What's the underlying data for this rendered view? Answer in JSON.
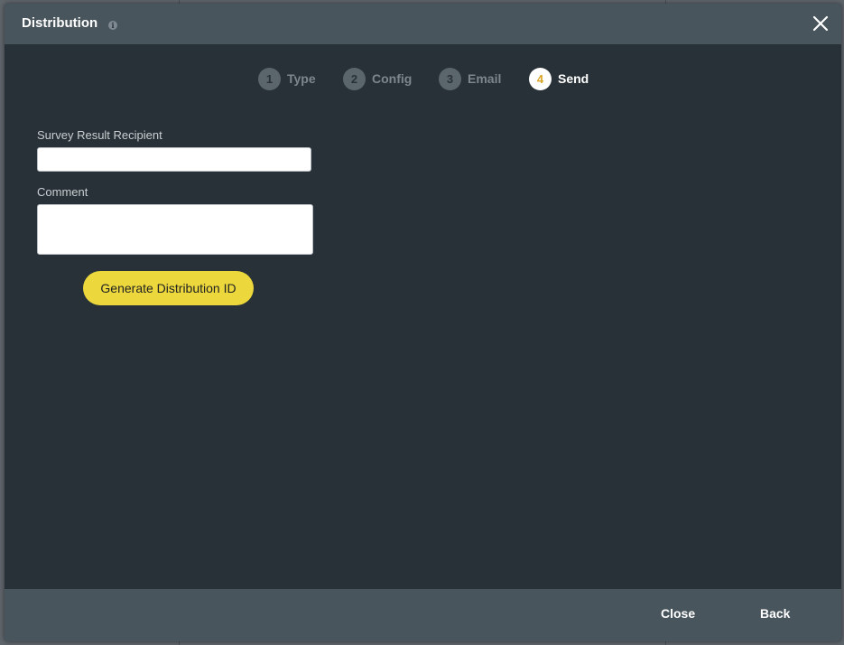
{
  "dialog": {
    "title": "Distribution",
    "info_icon": "info-icon",
    "close_icon": "close-icon"
  },
  "steps": [
    {
      "number": "1",
      "label": "Type",
      "active": false
    },
    {
      "number": "2",
      "label": "Config",
      "active": false
    },
    {
      "number": "3",
      "label": "Email",
      "active": false
    },
    {
      "number": "4",
      "label": "Send",
      "active": true
    }
  ],
  "form": {
    "recipient_label": "Survey Result Recipient",
    "recipient_value": "",
    "comment_label": "Comment",
    "comment_value": "",
    "generate_button": "Generate Distribution ID"
  },
  "footer": {
    "close_label": "Close",
    "back_label": "Back"
  },
  "colors": {
    "accent_yellow": "#ecd83c",
    "active_step_number": "#d9a423",
    "header_bg": "#48555c",
    "body_bg": "#283137"
  }
}
